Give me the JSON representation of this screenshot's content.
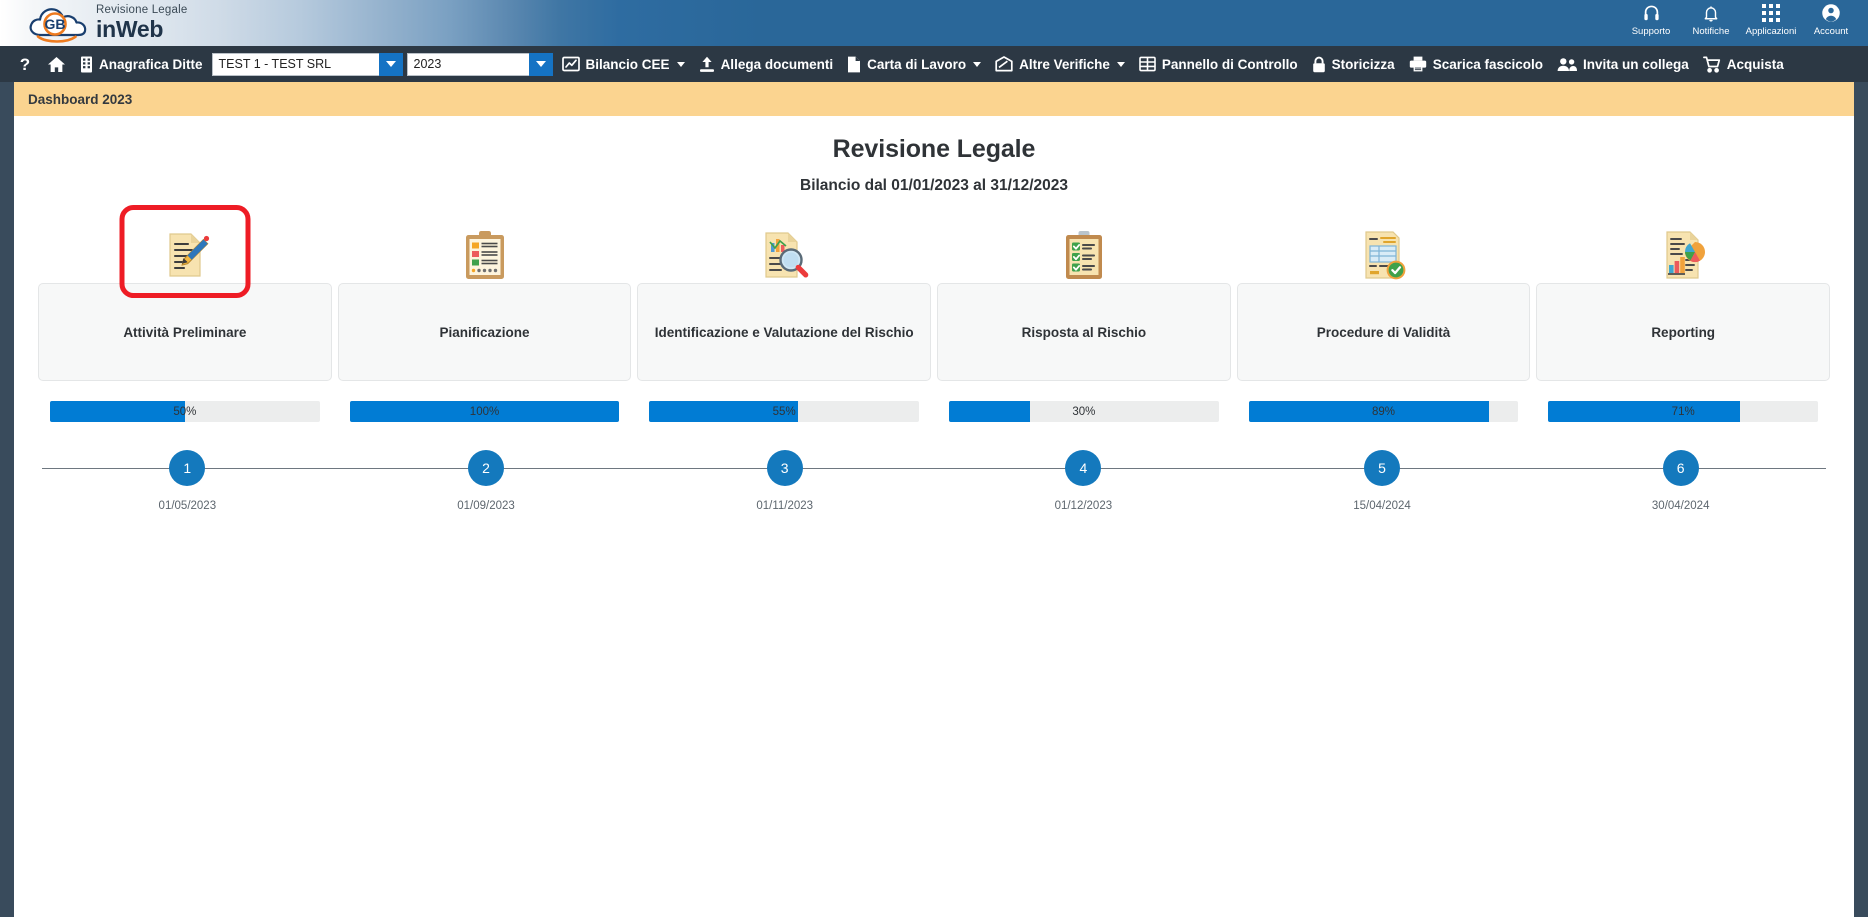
{
  "brand": {
    "line1": "Revisione Legale",
    "line2": "inWeb",
    "logo_icon": "gb-cloud-logo"
  },
  "brand_right": [
    {
      "label": "Supporto",
      "icon": "headset-icon"
    },
    {
      "label": "Notifiche",
      "icon": "bell-icon"
    },
    {
      "label": "Applicazioni",
      "icon": "grid-apps-icon"
    },
    {
      "label": "Account",
      "icon": "user-account-icon"
    }
  ],
  "toolbar": {
    "help_icon": "question-mark-icon",
    "home_icon": "home-icon",
    "building_icon": "building-icon",
    "anagrafica_label": "Anagrafica Ditte",
    "firm_value": "TEST 1 - TEST SRL",
    "year_value": "2023",
    "items": [
      {
        "label": "Bilancio CEE",
        "icon": "chart-line-icon",
        "caret": true
      },
      {
        "label": "Allega documenti",
        "icon": "upload-icon",
        "caret": false
      },
      {
        "label": "Carta di Lavoro",
        "icon": "document-icon",
        "caret": true
      },
      {
        "label": "Altre Verifiche",
        "icon": "envelope-open-icon",
        "caret": true
      },
      {
        "label": "Pannello di Controllo",
        "icon": "grid-table-icon",
        "caret": false
      },
      {
        "label": "Storicizza",
        "icon": "lock-icon",
        "caret": false
      },
      {
        "label": "Scarica fascicolo",
        "icon": "printer-icon",
        "caret": false
      },
      {
        "label": "Invita un collega",
        "icon": "users-icon",
        "caret": false
      },
      {
        "label": "Acquista",
        "icon": "cart-icon",
        "caret": false
      }
    ]
  },
  "page": {
    "header": "Dashboard 2023",
    "title": "Revisione Legale",
    "subtitle": "Bilancio dal 01/01/2023 al 31/12/2023"
  },
  "steps": [
    {
      "label": "Attività Preliminare",
      "icon": "document-pencil-icon",
      "percent": "50%",
      "value": 50,
      "date": "01/05/2023",
      "number": "1",
      "highlighted": true
    },
    {
      "label": "Pianificazione",
      "icon": "clipboard-colored-icon",
      "percent": "100%",
      "value": 100,
      "date": "01/09/2023",
      "number": "2",
      "highlighted": false
    },
    {
      "label": "Identificazione e Valutazione del Rischio",
      "icon": "document-magnifier-icon",
      "percent": "55%",
      "value": 55,
      "date": "01/11/2023",
      "number": "3",
      "highlighted": false
    },
    {
      "label": "Risposta al Rischio",
      "icon": "clipboard-check-icon",
      "percent": "30%",
      "value": 30,
      "date": "01/12/2023",
      "number": "4",
      "highlighted": false
    },
    {
      "label": "Procedure di Validità",
      "icon": "document-verified-icon",
      "percent": "89%",
      "value": 89,
      "date": "15/04/2024",
      "number": "5",
      "highlighted": false
    },
    {
      "label": "Reporting",
      "icon": "document-charts-icon",
      "percent": "71%",
      "value": 71,
      "date": "30/04/2024",
      "number": "6",
      "highlighted": false
    }
  ],
  "colors": {
    "accent_blue": "#017cd4",
    "dot_blue": "#1479bd",
    "header_yellow": "#fbd490",
    "toolbar_dark": "#2c3844",
    "page_frame": "#394b5c",
    "highlight_red": "#ee1c25"
  }
}
